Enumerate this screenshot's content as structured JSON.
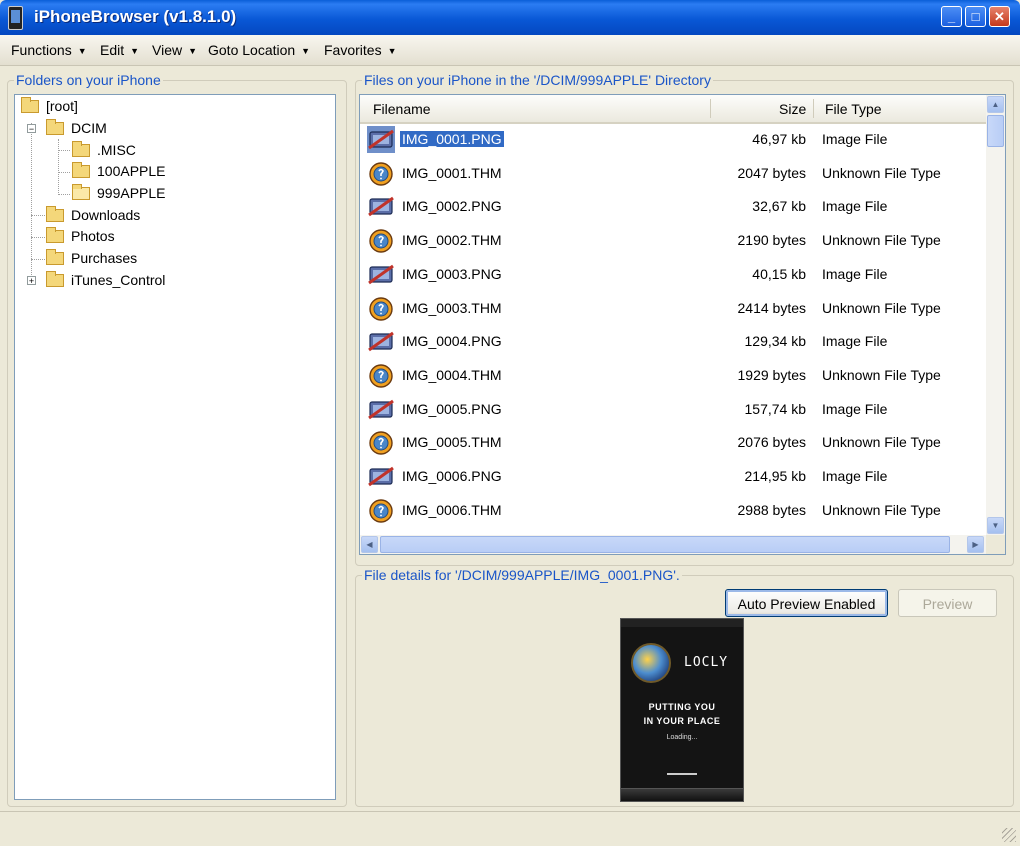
{
  "window": {
    "title": "iPhoneBrowser (v1.8.1.0)"
  },
  "menu": [
    {
      "label": "Functions"
    },
    {
      "label": "Edit"
    },
    {
      "label": "View"
    },
    {
      "label": "Goto Location"
    },
    {
      "label": "Favorites"
    }
  ],
  "folders_panel": {
    "title": "Folders on your iPhone",
    "tree": {
      "root": "[root]",
      "dcim": "DCIM",
      "misc": ".MISC",
      "apple100": "100APPLE",
      "apple999": "999APPLE",
      "downloads": "Downloads",
      "photos": "Photos",
      "purchases": "Purchases",
      "itunes": "iTunes_Control"
    }
  },
  "files_panel": {
    "title": "Files on your iPhone in the '/DCIM/999APPLE' Directory",
    "columns": {
      "filename": "Filename",
      "size": "Size",
      "type": "File Type"
    },
    "rows": [
      {
        "name": "IMG_0001.PNG",
        "size": "46,97 kb",
        "type": "Image File",
        "icon": "png-image-icon",
        "selected": true
      },
      {
        "name": "IMG_0001.THM",
        "size": "2047 bytes",
        "type": "Unknown File Type",
        "icon": "unknown-file-icon"
      },
      {
        "name": "IMG_0002.PNG",
        "size": "32,67 kb",
        "type": "Image File",
        "icon": "png-image-icon"
      },
      {
        "name": "IMG_0002.THM",
        "size": "2190 bytes",
        "type": "Unknown File Type",
        "icon": "unknown-file-icon"
      },
      {
        "name": "IMG_0003.PNG",
        "size": "40,15 kb",
        "type": "Image File",
        "icon": "png-image-icon"
      },
      {
        "name": "IMG_0003.THM",
        "size": "2414 bytes",
        "type": "Unknown File Type",
        "icon": "unknown-file-icon"
      },
      {
        "name": "IMG_0004.PNG",
        "size": "129,34 kb",
        "type": "Image File",
        "icon": "png-image-icon"
      },
      {
        "name": "IMG_0004.THM",
        "size": "1929 bytes",
        "type": "Unknown File Type",
        "icon": "unknown-file-icon"
      },
      {
        "name": "IMG_0005.PNG",
        "size": "157,74 kb",
        "type": "Image File",
        "icon": "png-image-icon"
      },
      {
        "name": "IMG_0005.THM",
        "size": "2076 bytes",
        "type": "Unknown File Type",
        "icon": "unknown-file-icon"
      },
      {
        "name": "IMG_0006.PNG",
        "size": "214,95 kb",
        "type": "Image File",
        "icon": "png-image-icon"
      },
      {
        "name": "IMG_0006.THM",
        "size": "2988 bytes",
        "type": "Unknown File Type",
        "icon": "unknown-file-icon"
      }
    ]
  },
  "details_panel": {
    "title": "File details for '/DCIM/999APPLE/IMG_0001.PNG'.",
    "auto_preview_label": "Auto Preview Enabled",
    "preview_label": "Preview",
    "preview_image": {
      "brand": "LOCLY",
      "tagline_1": "PUTTING YOU",
      "tagline_2": "IN YOUR PLACE",
      "loading": "Loading..."
    }
  },
  "colors": {
    "titlebar": "#0a5fd8",
    "group_title": "#1a55c8",
    "selection": "#316ac5",
    "window_bg": "#ece9d8"
  }
}
